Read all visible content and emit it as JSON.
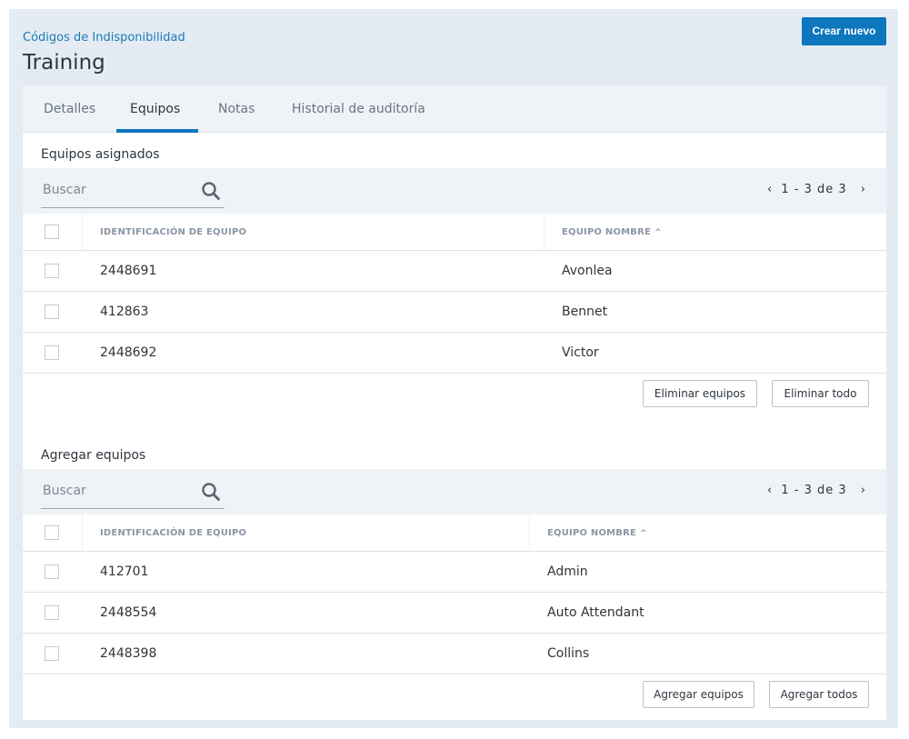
{
  "header": {
    "breadcrumb": "Códigos de Indisponibilidad",
    "title": "Training",
    "create_button": "Crear nuevo"
  },
  "tabs": [
    {
      "label": "Detalles",
      "active": false
    },
    {
      "label": "Equipos",
      "active": true
    },
    {
      "label": "Notas",
      "active": false
    },
    {
      "label": "Historial de auditoría",
      "active": false
    }
  ],
  "assigned": {
    "title": "Equipos asignados",
    "search_placeholder": "Buscar",
    "pager": {
      "prev": "‹",
      "text": "1 - 3 de 3",
      "next": "›"
    },
    "columns": {
      "id": "IDENTIFICACIÓN DE EQUIPO",
      "name": "EQUIPO NOMBRE",
      "sort_indicator": "^"
    },
    "rows": [
      {
        "id": "2448691",
        "name": "Avonlea"
      },
      {
        "id": "412863",
        "name": "Bennet"
      },
      {
        "id": "2448692",
        "name": "Victor"
      }
    ],
    "remove_button": "Eliminar equipos",
    "remove_all_button": "Eliminar todo"
  },
  "available": {
    "title": "Agregar equipos",
    "search_placeholder": "Buscar",
    "pager": {
      "prev": "‹",
      "text": "1 - 3 de 3",
      "next": "›"
    },
    "columns": {
      "id": "IDENTIFICACIÓN DE EQUIPO",
      "name": "EQUIPO NOMBRE",
      "sort_indicator": "^"
    },
    "rows": [
      {
        "id": "412701",
        "name": "Admin"
      },
      {
        "id": "2448554",
        "name": "Auto Attendant"
      },
      {
        "id": "2448398",
        "name": "Collins"
      }
    ],
    "add_button": "Agregar equipos",
    "add_all_button": "Agregar todos"
  },
  "colors": {
    "accent": "#0e76bd",
    "page_bg": "#e4ebf3",
    "toolbar_bg": "#eef3f7",
    "link": "#1a7ab8"
  }
}
